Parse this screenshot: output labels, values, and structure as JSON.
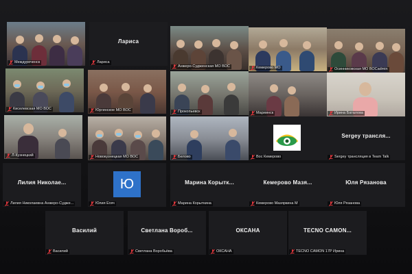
{
  "colors": {
    "tile_bg": "#1c1c1f",
    "active_outline": "#c8d64a",
    "mic_muted": "#e0393e",
    "avatar_bg": "#2e72c9"
  },
  "tiles": [
    {
      "label": "Междуреченск",
      "center_name": "",
      "video": true
    },
    {
      "label": "Лариса",
      "center_name": "Лариса",
      "video": false
    },
    {
      "label": "Анжеро-Судженская МО ВОС",
      "center_name": "",
      "video": true
    },
    {
      "label": "Кемерово МО",
      "center_name": "",
      "video": true
    },
    {
      "label": "Осинниковская МО ВОСadmin",
      "center_name": "",
      "video": true
    },
    {
      "label": "Киселевская МО ВОС",
      "center_name": "",
      "video": true
    },
    {
      "label": "Юргинское МО ВОС",
      "center_name": "",
      "video": true
    },
    {
      "label": "Прокопьевск",
      "center_name": "",
      "video": true
    },
    {
      "label": "Мариинск",
      "center_name": "",
      "video": true
    },
    {
      "label": "Ирина Баталова",
      "center_name": "",
      "video": true
    },
    {
      "label": "Л-Кузнецкий",
      "center_name": "",
      "video": true
    },
    {
      "label": "Новокузнецкая МО ВОС",
      "center_name": "",
      "video": true
    },
    {
      "label": "Белово",
      "center_name": "",
      "video": true
    },
    {
      "label": "Вос Кемерово",
      "center_name": "",
      "video": false
    },
    {
      "label": "Sergey трансляция в Team Talk",
      "center_name": "Sergey трансля...",
      "video": false
    },
    {
      "label": "Лилия Николаевна Анжеро-Судже...",
      "center_name": "Лилия Николае...",
      "video": false
    },
    {
      "label": "Юлия Егич",
      "center_name": "",
      "video": false,
      "avatar_letter": "Ю"
    },
    {
      "label": "Марина Корыткина",
      "center_name": "Марина Корытк...",
      "video": false
    },
    {
      "label": "Кемерово Мазяркина М",
      "center_name": "Кемерово Мазя...",
      "video": false
    },
    {
      "label": "Юля Рязанова",
      "center_name": "Юля Рязанова",
      "video": false
    },
    {
      "label": "Василий",
      "center_name": "Василий",
      "video": false
    },
    {
      "label": "Светлана Воробьёва",
      "center_name": "Светлана Вороб...",
      "video": false
    },
    {
      "label": "ОКСАНА",
      "center_name": "ОКСАНА",
      "video": false
    },
    {
      "label": "TECNO CAMON 17P Ирина",
      "center_name": "TECNO CAMON...",
      "video": false
    }
  ]
}
